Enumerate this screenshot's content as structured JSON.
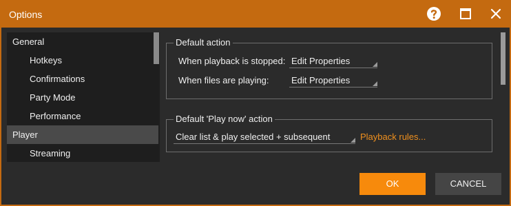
{
  "window": {
    "title": "Options",
    "accent": "#c46a10",
    "controls": [
      "help-icon",
      "maximize-icon",
      "close-icon"
    ]
  },
  "sidebar": {
    "items": [
      {
        "label": "General",
        "level": 0
      },
      {
        "label": "Hotkeys",
        "level": 1
      },
      {
        "label": "Confirmations",
        "level": 1
      },
      {
        "label": "Party Mode",
        "level": 1
      },
      {
        "label": "Performance",
        "level": 1
      },
      {
        "label": "Player",
        "level": 0,
        "selected": true
      },
      {
        "label": "Streaming",
        "level": 1
      }
    ]
  },
  "default_action": {
    "legend": "Default action",
    "stopped_label": "When playback is stopped:",
    "stopped_value": "Edit Properties",
    "playing_label": "When files are playing:",
    "playing_value": "Edit Properties"
  },
  "play_now": {
    "legend": "Default 'Play now' action",
    "value": "Clear list & play selected + subsequent",
    "link": "Playback rules..."
  },
  "buttons": {
    "ok": "OK",
    "cancel": "CANCEL"
  },
  "colors": {
    "ok_button": "#f78a0c",
    "link": "#f0901e",
    "background": "#2b2b2b"
  }
}
